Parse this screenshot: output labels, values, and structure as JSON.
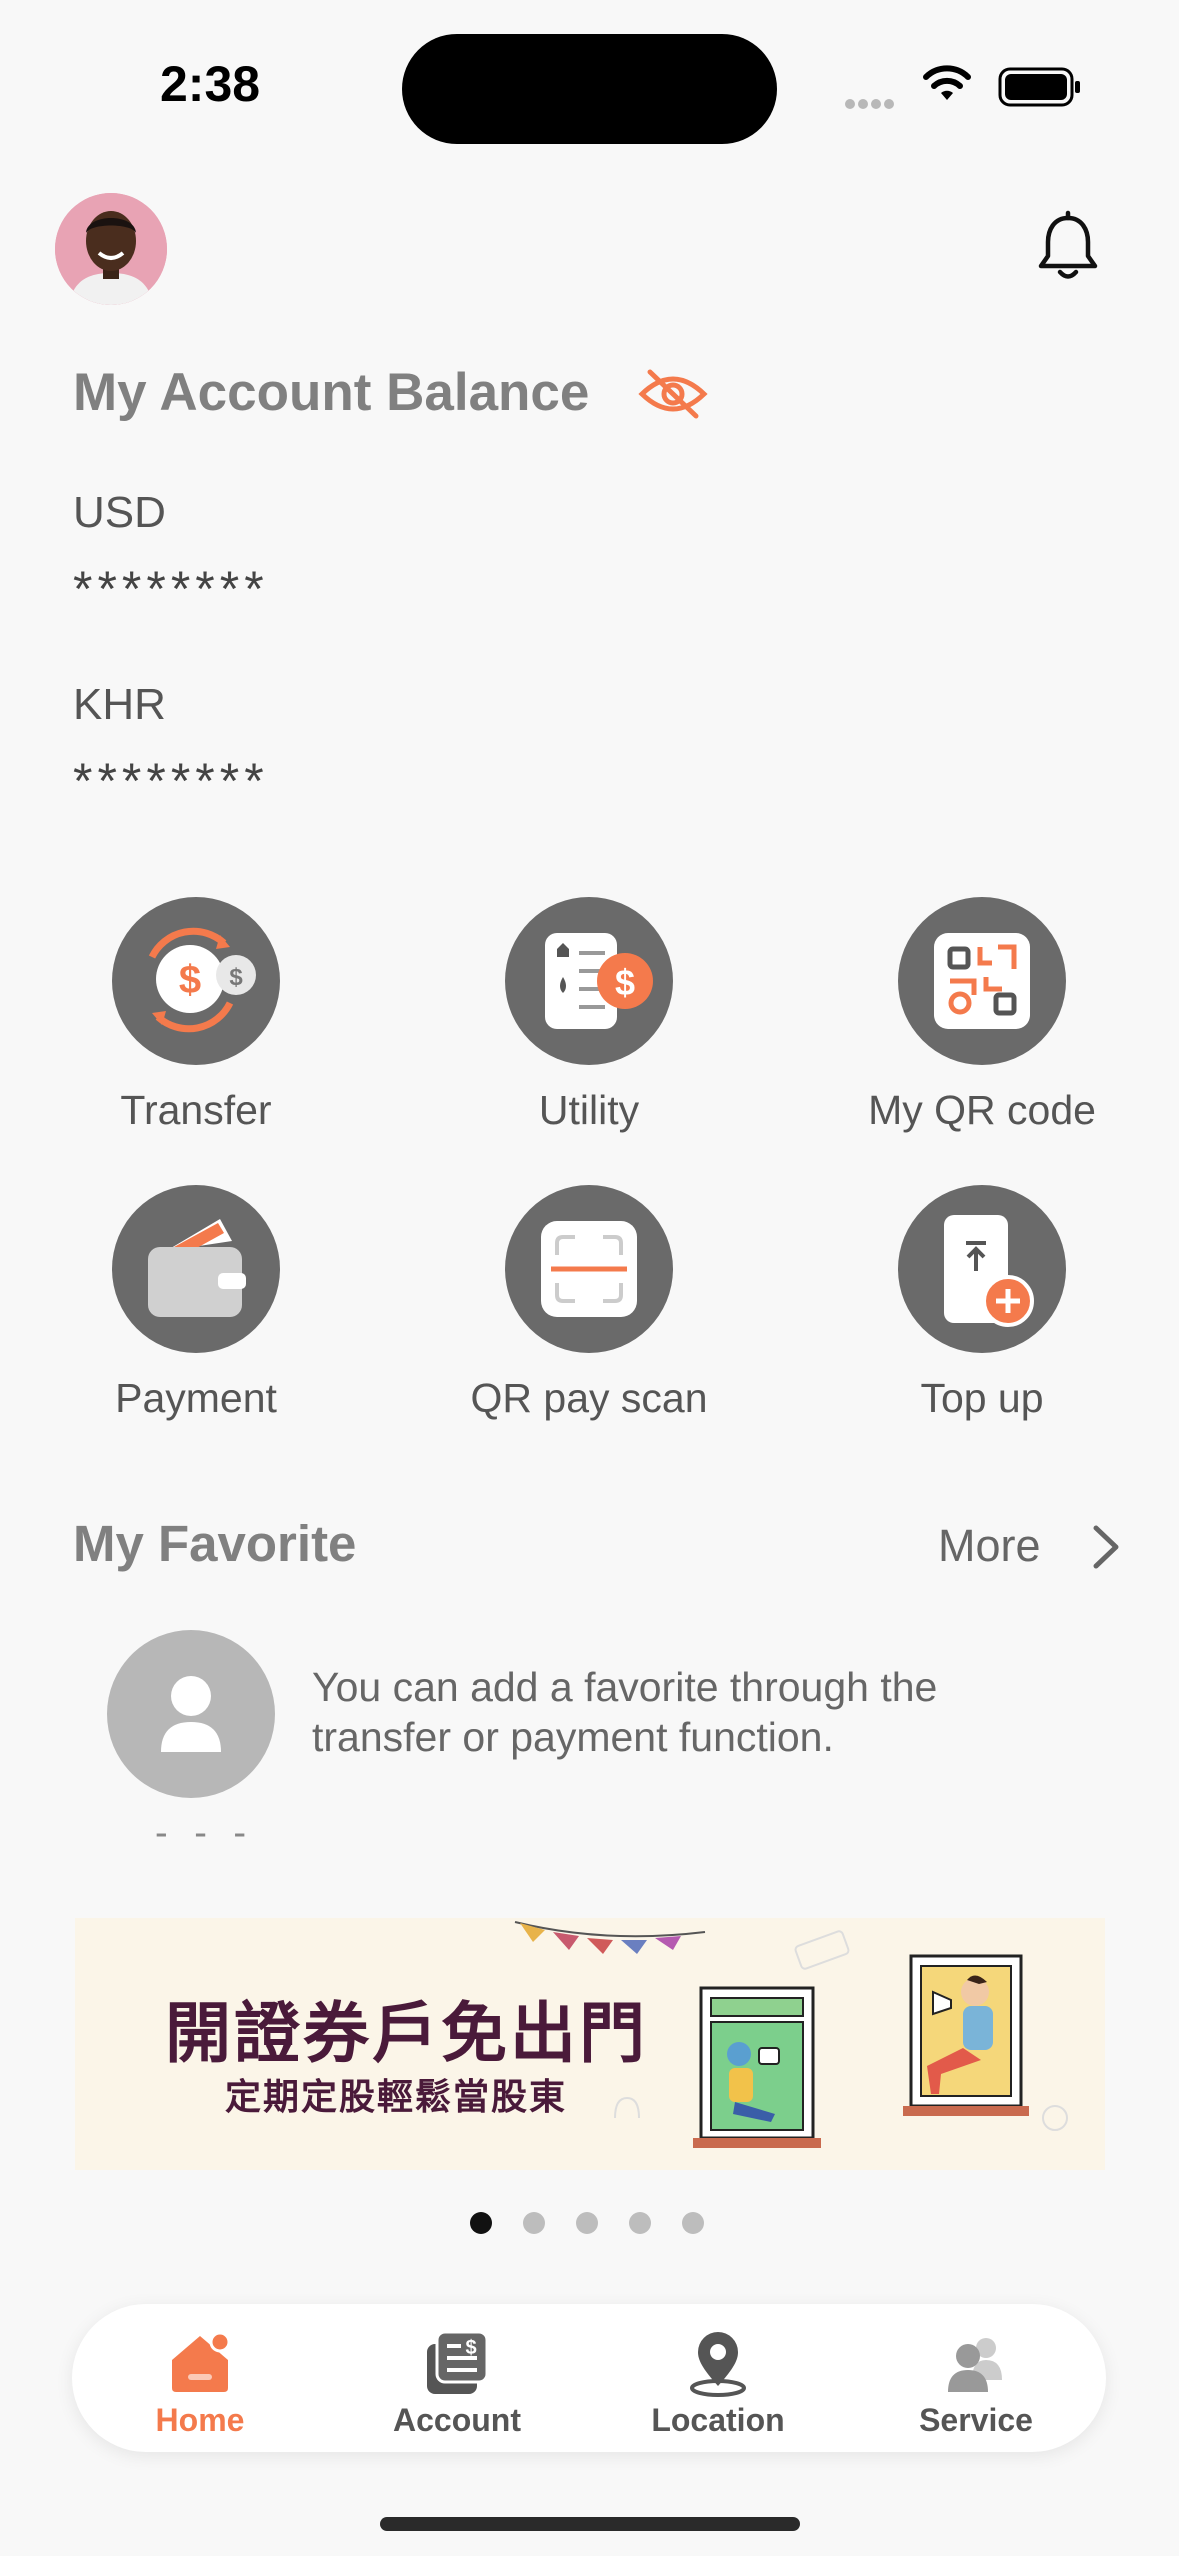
{
  "status_bar": {
    "time": "2:38"
  },
  "balance": {
    "title": "My Account Balance",
    "accounts": [
      {
        "currency": "USD",
        "value": "********"
      },
      {
        "currency": "KHR",
        "value": "********"
      }
    ]
  },
  "actions": [
    {
      "label": "Transfer",
      "icon": "transfer-icon"
    },
    {
      "label": "Utility",
      "icon": "utility-icon"
    },
    {
      "label": "My QR code",
      "icon": "qr-code-icon"
    },
    {
      "label": "Payment",
      "icon": "wallet-icon"
    },
    {
      "label": "QR pay scan",
      "icon": "scan-icon"
    },
    {
      "label": "Top up",
      "icon": "top-up-icon"
    }
  ],
  "favorite": {
    "title": "My Favorite",
    "more_label": "More",
    "placeholder_name": "- - -",
    "empty_text": "You can add a favorite through the transfer or payment function."
  },
  "banner": {
    "headline": "開證券戶免出門",
    "subline": "定期定股輕鬆當股東",
    "page_count": 5,
    "active_index": 0
  },
  "tabs": [
    {
      "label": "Home",
      "icon": "home-icon",
      "active": true
    },
    {
      "label": "Account",
      "icon": "account-icon",
      "active": false
    },
    {
      "label": "Location",
      "icon": "location-pin-icon",
      "active": false
    },
    {
      "label": "Service",
      "icon": "service-icon",
      "active": false
    }
  ],
  "colors": {
    "accent": "#f47a4c",
    "icon_circle": "#6a6a6a",
    "title_gray": "#808080",
    "background": "#f8f8f8"
  }
}
